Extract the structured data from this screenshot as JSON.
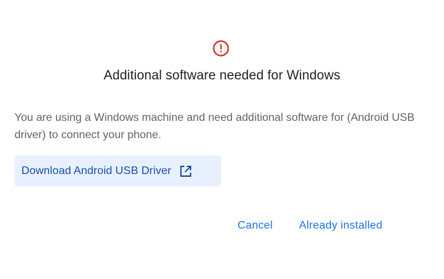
{
  "dialog": {
    "icon": "error-alert-icon",
    "title": "Additional software needed for Windows",
    "message": "You are using a Windows machine and need additional software for (Android USB driver) to connect your phone.",
    "download_button": {
      "label": "Download Android USB Driver",
      "icon": "open-in-new-icon"
    },
    "actions": {
      "cancel": "Cancel",
      "already_installed": "Already installed"
    }
  },
  "colors": {
    "alert_red": "#d93025",
    "title_text": "#202124",
    "body_text": "#5f6368",
    "button_bg": "#e8f0fe",
    "button_text": "#174ea6",
    "link_blue": "#1a73e8"
  }
}
